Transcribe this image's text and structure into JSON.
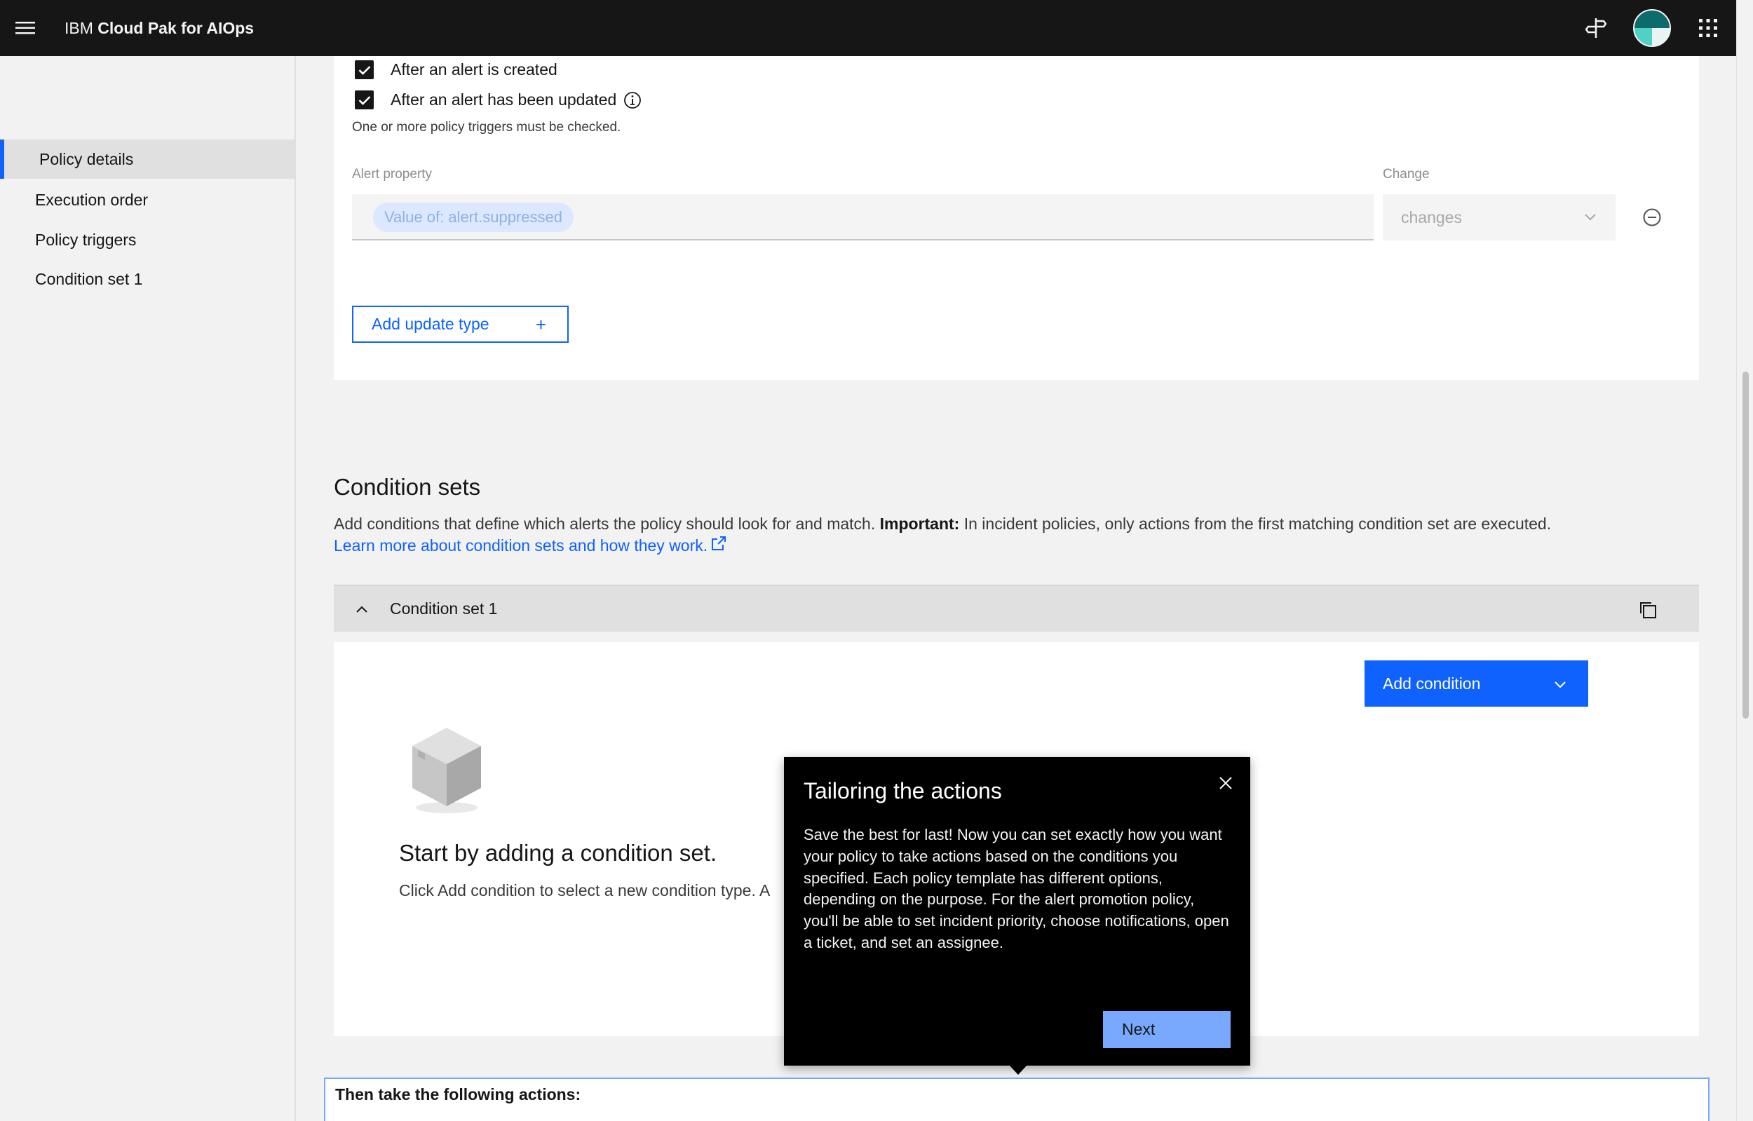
{
  "header": {
    "brand_prefix": "IBM",
    "brand_name": "Cloud Pak for AIOps",
    "icons": [
      "menu-icon",
      "signpost-icon",
      "avatar",
      "app-switcher-icon"
    ]
  },
  "leftnav": {
    "items": [
      {
        "label": "Policy details",
        "active": true
      },
      {
        "label": "Execution order",
        "active": false
      },
      {
        "label": "Policy triggers",
        "active": false
      },
      {
        "label": "Condition set 1",
        "active": false
      }
    ]
  },
  "triggers": {
    "created_label": "After an alert is created",
    "updated_label": "After an alert has been updated",
    "helper": "One or more policy triggers must be checked.",
    "alert_property_label": "Alert property",
    "alert_property_value": "Value of: alert.suppressed",
    "change_label": "Change",
    "change_value": "changes",
    "add_update_type": "Add update type"
  },
  "condition_sets": {
    "title": "Condition sets",
    "desc_prefix": "Add conditions that define which alerts the policy should look for and match. ",
    "desc_important": "Important:",
    "desc_suffix": " In incident policies, only actions from the first matching condition set are executed.",
    "learn_more": "Learn more about condition sets and how they work.",
    "set_title": "Condition set 1",
    "add_condition": "Add condition",
    "empty_title": "Start by adding a condition set.",
    "empty_desc": "Click Add condition to select a new condition type. A"
  },
  "actions": {
    "title": "Then take the following actions:"
  },
  "popover": {
    "title": "Tailoring the actions",
    "body": "Save the best for last! Now you can set exactly how you want your policy to take actions based on the conditions you specified. Each policy template has different options, depending on the purpose. For the alert promotion policy, you'll be able to set incident priority, choose notifications, open a ticket, and set an assignee.",
    "next": "Next"
  },
  "colors": {
    "accent": "#0f62fe",
    "header_bg": "#161616",
    "popover_bg": "#000000",
    "next_button": "#78a9ff"
  }
}
